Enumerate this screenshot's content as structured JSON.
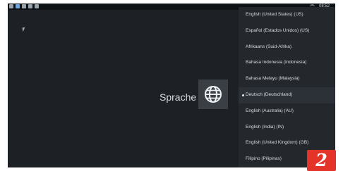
{
  "status_bar": {
    "left_icons": [
      "notification-icon",
      "tv-icon",
      "camera-icon",
      "image-icon",
      "settings-icon"
    ],
    "time": "08:52"
  },
  "main": {
    "title": "Sprache"
  },
  "languages": [
    "English (United States) (US)",
    "Español (Estados Unidos) (US)",
    "Afrikaans (Suid-Afrika)",
    "Bahasa Indonesia (Indonesia)",
    "Bahasa Melayu (Malaysia)",
    "Deutsch (Deutschland)",
    "English (Australia) (AU)",
    "English (India) (IN)",
    "English (United Kingdom) (GB)",
    "Filipino (Pilipinas)"
  ],
  "selected_language_index": 5,
  "badge": "2",
  "colors": {
    "background": "#1d2126",
    "menu": "#24282d",
    "badge": "#e4342a"
  }
}
